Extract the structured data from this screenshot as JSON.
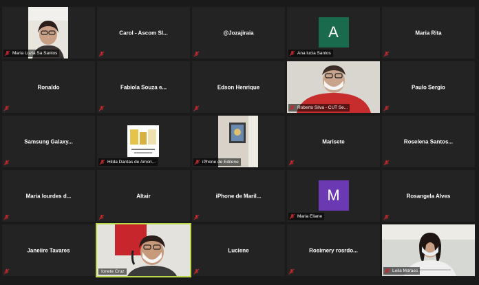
{
  "colors": {
    "muted_icon": "#c0282d",
    "tile_bg": "#232323",
    "speaker_border": "#b9d84a",
    "avatar_a": "#1a6b4e",
    "avatar_m": "#6b3ab3"
  },
  "participants": [
    {
      "name": "Maria Luzia Sa Santos",
      "video": true
    },
    {
      "name": "Carol - Ascom SI...",
      "video": false
    },
    {
      "name": "@Jozajiraia",
      "video": false
    },
    {
      "name": "Ana lucia Santos",
      "video": false,
      "avatar": "A"
    },
    {
      "name": "Maria Rita",
      "video": false
    },
    {
      "name": "Ronaldo",
      "video": false
    },
    {
      "name": "Fabiola Souza e...",
      "video": false
    },
    {
      "name": "Edson Henrique",
      "video": false
    },
    {
      "name": "Roberto Silva - CUT Se...",
      "video": true
    },
    {
      "name": "Paulo Sergio",
      "video": false
    },
    {
      "name": "Samsung  Galaxy...",
      "video": false
    },
    {
      "name": "Hilda Dantas de Amori...",
      "video": true
    },
    {
      "name": "iPhone de Edilene",
      "video": true
    },
    {
      "name": "Marisete",
      "video": false
    },
    {
      "name": "Roselena  Santos...",
      "video": false
    },
    {
      "name": "Maria lourdes d...",
      "video": false
    },
    {
      "name": "Altair",
      "video": false
    },
    {
      "name": "iPhone de Maril...",
      "video": false
    },
    {
      "name": "Maria Eliane",
      "video": false,
      "avatar": "M"
    },
    {
      "name": "Rosangela Alves",
      "video": false
    },
    {
      "name": "Janeiire Tavares",
      "video": false
    },
    {
      "name": "Ionete Cruz",
      "video": true,
      "speaking": true
    },
    {
      "name": "Luciene",
      "video": false
    },
    {
      "name": "Rosimery  rosrdo...",
      "video": false
    },
    {
      "name": "Leila Moraes",
      "video": true
    }
  ]
}
